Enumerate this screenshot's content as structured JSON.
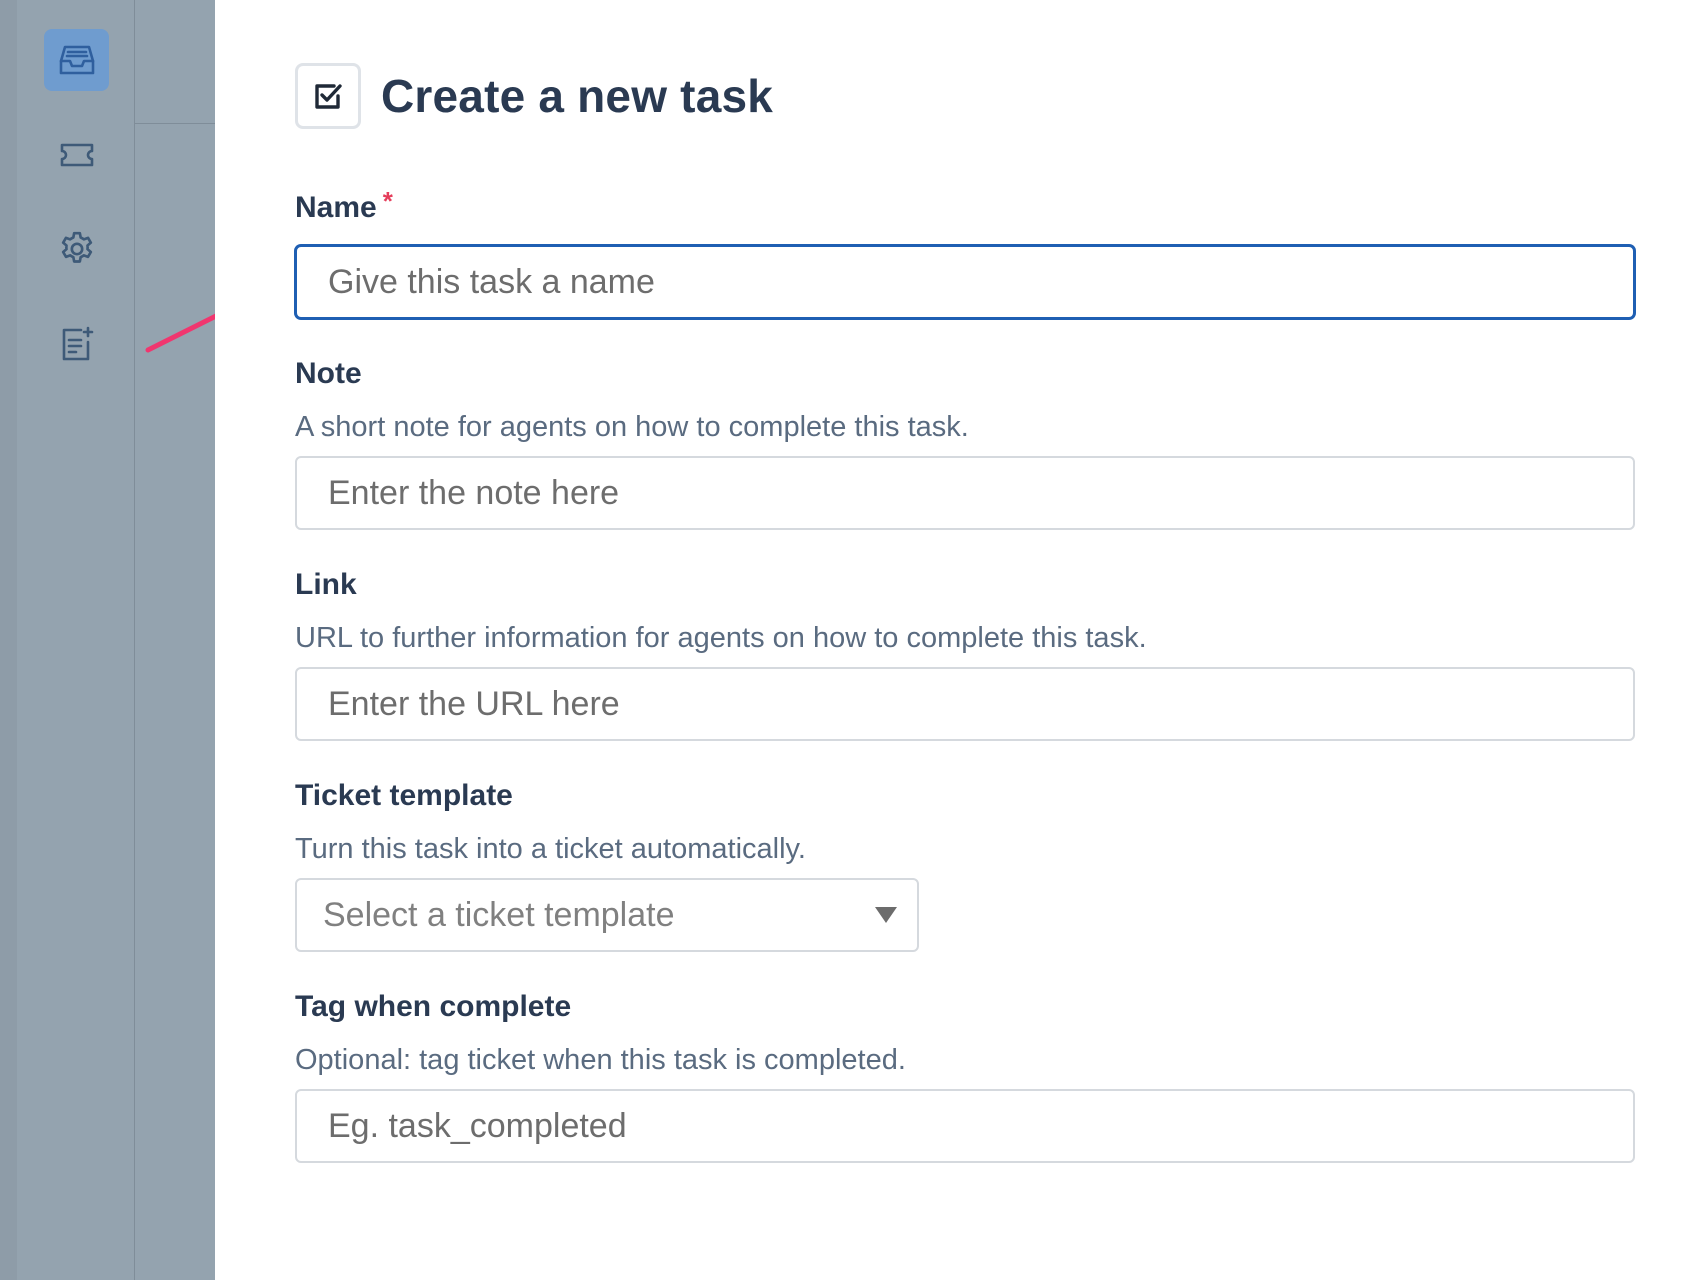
{
  "colors": {
    "rail": "#94a3af",
    "rail_active": "#6f9ccf",
    "title": "#2a3a52",
    "required": "#e53e5b",
    "focus_border": "#1f5fb3",
    "annotation_arrow": "#f0366f"
  },
  "sidebar": {
    "items": [
      {
        "icon": "inbox-icon",
        "active": true
      },
      {
        "icon": "ticket-icon",
        "active": false
      },
      {
        "icon": "gear-icon",
        "active": false
      },
      {
        "icon": "task-list-icon",
        "active": false
      }
    ]
  },
  "header": {
    "icon": "checkbox-edit-icon",
    "title": "Create a new task"
  },
  "form": {
    "name": {
      "label": "Name",
      "required_mark": "*",
      "placeholder": "Give this task a name",
      "value": ""
    },
    "note": {
      "label": "Note",
      "help": "A short note for agents on how to complete this task.",
      "placeholder": "Enter the note here",
      "value": ""
    },
    "link": {
      "label": "Link",
      "help": "URL to further information for agents on how to complete this task.",
      "placeholder": "Enter the URL here",
      "value": ""
    },
    "ticket_template": {
      "label": "Ticket template",
      "help": "Turn this task into a ticket automatically.",
      "selected": "Select a ticket template"
    },
    "tag_when_complete": {
      "label": "Tag when complete",
      "help": "Optional: tag ticket when this task is completed.",
      "placeholder": "Eg. task_completed",
      "value": ""
    }
  },
  "annotation": {
    "icon": "pointer-arrow-icon"
  }
}
